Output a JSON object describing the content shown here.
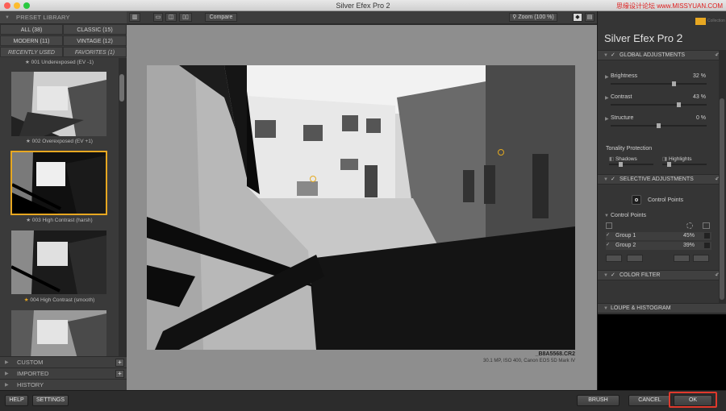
{
  "window": {
    "title": "Silver Efex Pro 2",
    "watermark": "思缘设计论坛 www.MISSYUAN.COM",
    "colors": {
      "accent": "#e7a721",
      "highlight": "#e0392c"
    }
  },
  "left_panel": {
    "header": "PRESET LIBRARY",
    "filters": [
      {
        "label": "ALL (38)"
      },
      {
        "label": "CLASSIC (15)"
      },
      {
        "label": "MODERN (11)"
      },
      {
        "label": "VINTAGE (12)"
      },
      {
        "label": "RECENTLY USED"
      },
      {
        "label": "FAVORITES (1)"
      }
    ],
    "presets": [
      {
        "label": "001 Underexposed (EV -1)",
        "star": "gray"
      },
      {
        "label": "002 Overexposed (EV +1)",
        "star": "gray"
      },
      {
        "label": "003 High Contrast (harsh)",
        "star": "gray",
        "selected": true
      },
      {
        "label": "004 High Contrast (smooth)",
        "star": "gold"
      },
      {
        "label": "",
        "star": "gray"
      }
    ],
    "sections": [
      {
        "label": "CUSTOM"
      },
      {
        "label": "IMPORTED"
      },
      {
        "label": "HISTORY"
      }
    ]
  },
  "toolbar": {
    "compare": "Compare",
    "zoom": "Zoom (100 %)"
  },
  "image": {
    "file_name": "_B8A5568.CR2",
    "file_info": "30.1 MP, ISO 400, Canon EOS 5D Mark IV"
  },
  "right_panel": {
    "app_title": "Silver Efex Pro",
    "app_version": "2",
    "brand": "Collection",
    "global_adjustments": {
      "header": "GLOBAL ADJUSTMENTS",
      "sliders": [
        {
          "label": "Brightness",
          "value": "32 %",
          "pos": 0.66
        },
        {
          "label": "Contrast",
          "value": "43 %",
          "pos": 0.71
        },
        {
          "label": "Structure",
          "value": "0 %",
          "pos": 0.5
        }
      ],
      "tonality": {
        "label": "Tonality Protection",
        "shadows": "Shadows",
        "highlights": "Highlights"
      }
    },
    "selective_adjustments": {
      "header": "SELECTIVE ADJUSTMENTS",
      "control_points_button": "Control Points",
      "list_header": "Control Points",
      "groups": [
        {
          "label": "Group 1",
          "value": "45%"
        },
        {
          "label": "Group 2",
          "value": "39%"
        }
      ]
    },
    "color_filter": {
      "header": "COLOR FILTER",
      "dots": [
        "#7d7d7d",
        "#c75650",
        "#d48f38",
        "#c4b43d",
        "#52a149",
        "#5a89c4"
      ]
    },
    "loupe": {
      "header": "LOUPE & HISTOGRAM"
    }
  },
  "bottom": {
    "help": "HELP",
    "settings": "SETTINGS",
    "brush": "BRUSH",
    "cancel": "CANCEL",
    "ok": "OK"
  }
}
